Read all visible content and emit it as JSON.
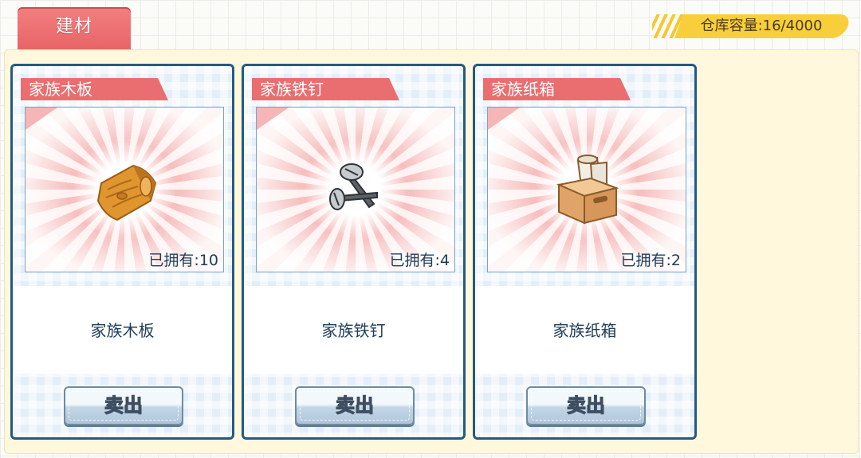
{
  "tab": {
    "label": "建材"
  },
  "capacity": {
    "text": "仓库容量:16/4000"
  },
  "items": [
    {
      "ribbon": "家族木板",
      "name": "家族木板",
      "owned_label": "已拥有:",
      "owned_count": "10",
      "sell_label": "卖出",
      "icon": "wood-plank-icon"
    },
    {
      "ribbon": "家族铁钉",
      "name": "家族铁钉",
      "owned_label": "已拥有:",
      "owned_count": "4",
      "sell_label": "卖出",
      "icon": "iron-nail-icon"
    },
    {
      "ribbon": "家族纸箱",
      "name": "家族纸箱",
      "owned_label": "已拥有:",
      "owned_count": "2",
      "sell_label": "卖出",
      "icon": "paper-box-icon"
    }
  ],
  "colors": {
    "tab": "#e86466",
    "capacity_badge": "#f8cf3a",
    "card_border": "#235a84",
    "ribbon": "#ea6d70"
  }
}
